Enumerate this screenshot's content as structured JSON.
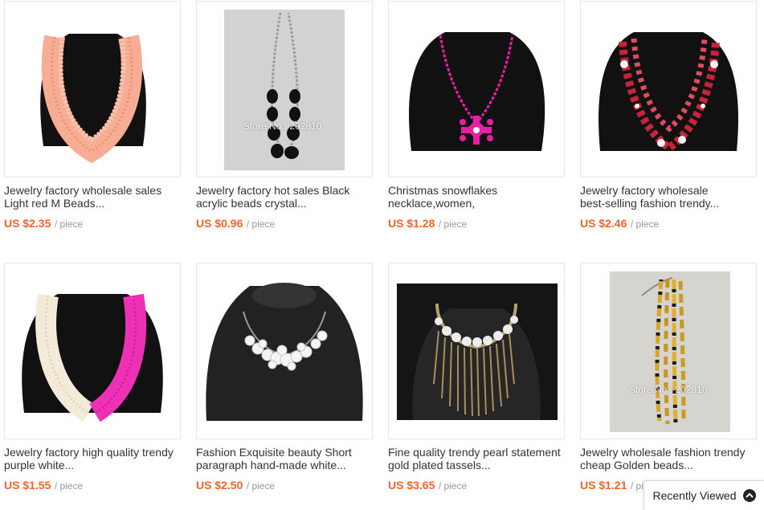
{
  "products": [
    {
      "title_lines": [
        "Jewelry factory wholesale sales",
        "Light red M Beads..."
      ],
      "price": "US $2.35",
      "unit": "/ piece",
      "image": "coral-seed-bead-necklace",
      "watermark": ""
    },
    {
      "title_lines": [
        "Jewelry factory hot sales Black",
        "acrylic beads crystal..."
      ],
      "price": "US $0.96",
      "unit": "/ piece",
      "image": "black-acrylic-bead-chain-necklace",
      "watermark": "Store No.: 202810"
    },
    {
      "title_lines": [
        "Christmas snowflakes",
        "necklace,women,"
      ],
      "price": "US $1.28",
      "unit": "/ piece",
      "image": "pink-snowflake-pendant-necklace",
      "watermark": ""
    },
    {
      "title_lines": [
        "Jewelry factory wholesale",
        "best-selling fashion trendy..."
      ],
      "price": "US $2.46",
      "unit": "/ piece",
      "image": "red-crystal-bead-necklace",
      "watermark": ""
    },
    {
      "title_lines": [
        "Jewelry factory high quality trendy",
        "purple white..."
      ],
      "price": "US $1.55",
      "unit": "/ piece",
      "image": "purple-white-multistrand-necklace",
      "watermark": ""
    },
    {
      "title_lines": [
        "Fashion Exquisite beauty Short",
        "paragraph hand-made white..."
      ],
      "price": "US $2.50",
      "unit": "/ piece",
      "image": "white-pearl-cluster-necklace",
      "watermark": ""
    },
    {
      "title_lines": [
        "Fine quality trendy pearl statement",
        "gold plated tassels..."
      ],
      "price": "US $3.65",
      "unit": "/ piece",
      "image": "gold-tassel-pearl-statement-necklace",
      "watermark": ""
    },
    {
      "title_lines": [
        "Jewelry wholesale fashion trendy",
        "cheap Golden beads..."
      ],
      "price": "US $1.21",
      "unit": "/ piece",
      "image": "golden-black-bead-necklace",
      "watermark": "Store No.: 202810"
    }
  ],
  "recently_viewed": {
    "label": "Recently Viewed",
    "icon": "chevron-up-icon"
  },
  "colors": {
    "price": "#f3632a",
    "unit": "#999999",
    "title": "#333333",
    "border": "#e6e6e6"
  }
}
